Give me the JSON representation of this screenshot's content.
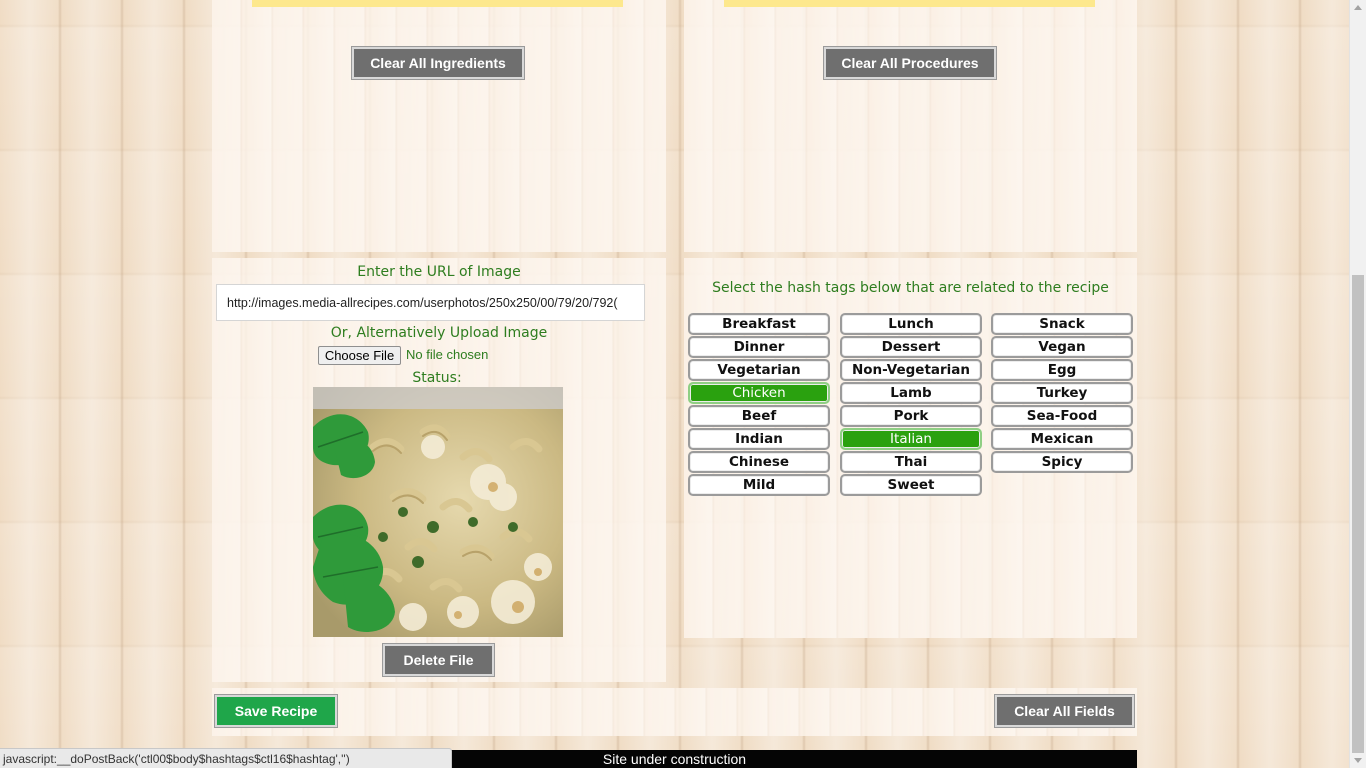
{
  "ingredients": {
    "clear_label": "Clear All Ingredients"
  },
  "procedures": {
    "clear_label": "Clear All Procedures"
  },
  "image_section": {
    "url_prompt": "Enter the URL of Image",
    "url_value": "http://images.media-allrecipes.com/userphotos/250x250/00/79/20/792(",
    "upload_prompt": "Or, Alternatively Upload Image",
    "choose_file_label": "Choose File",
    "no_file_text": "No file chosen",
    "status_label": "Status:",
    "delete_label": "Delete File"
  },
  "hashtags": {
    "prompt": "Select the hash tags below that are related to the recipe",
    "tags": [
      {
        "label": "Breakfast",
        "selected": false
      },
      {
        "label": "Lunch",
        "selected": false
      },
      {
        "label": "Snack",
        "selected": false
      },
      {
        "label": "Dinner",
        "selected": false
      },
      {
        "label": "Dessert",
        "selected": false
      },
      {
        "label": "Vegan",
        "selected": false
      },
      {
        "label": "Vegetarian",
        "selected": false
      },
      {
        "label": "Non-Vegetarian",
        "selected": false
      },
      {
        "label": "Egg",
        "selected": false
      },
      {
        "label": "Chicken",
        "selected": true
      },
      {
        "label": "Lamb",
        "selected": false
      },
      {
        "label": "Turkey",
        "selected": false
      },
      {
        "label": "Beef",
        "selected": false
      },
      {
        "label": "Pork",
        "selected": false
      },
      {
        "label": "Sea-Food",
        "selected": false
      },
      {
        "label": "Indian",
        "selected": false
      },
      {
        "label": "Italian",
        "selected": true
      },
      {
        "label": "Mexican",
        "selected": false
      },
      {
        "label": "Chinese",
        "selected": false
      },
      {
        "label": "Thai",
        "selected": false
      },
      {
        "label": "Spicy",
        "selected": false
      },
      {
        "label": "Mild",
        "selected": false
      },
      {
        "label": "Sweet",
        "selected": false
      }
    ],
    "selected_color": "#2aa10f"
  },
  "footer": {
    "save_label": "Save Recipe",
    "clear_all_label": "Clear All Fields",
    "construction_text": "Site under construction"
  },
  "browser_status": {
    "url": "javascript:__doPostBack('ctl00$body$hashtags$ctl16$hashtag','')"
  },
  "colors": {
    "accent_green": "#1fa64a",
    "label_green": "#2e7d1f",
    "button_gray": "#6f6f6f",
    "highlight_yellow": "#fde88d"
  }
}
